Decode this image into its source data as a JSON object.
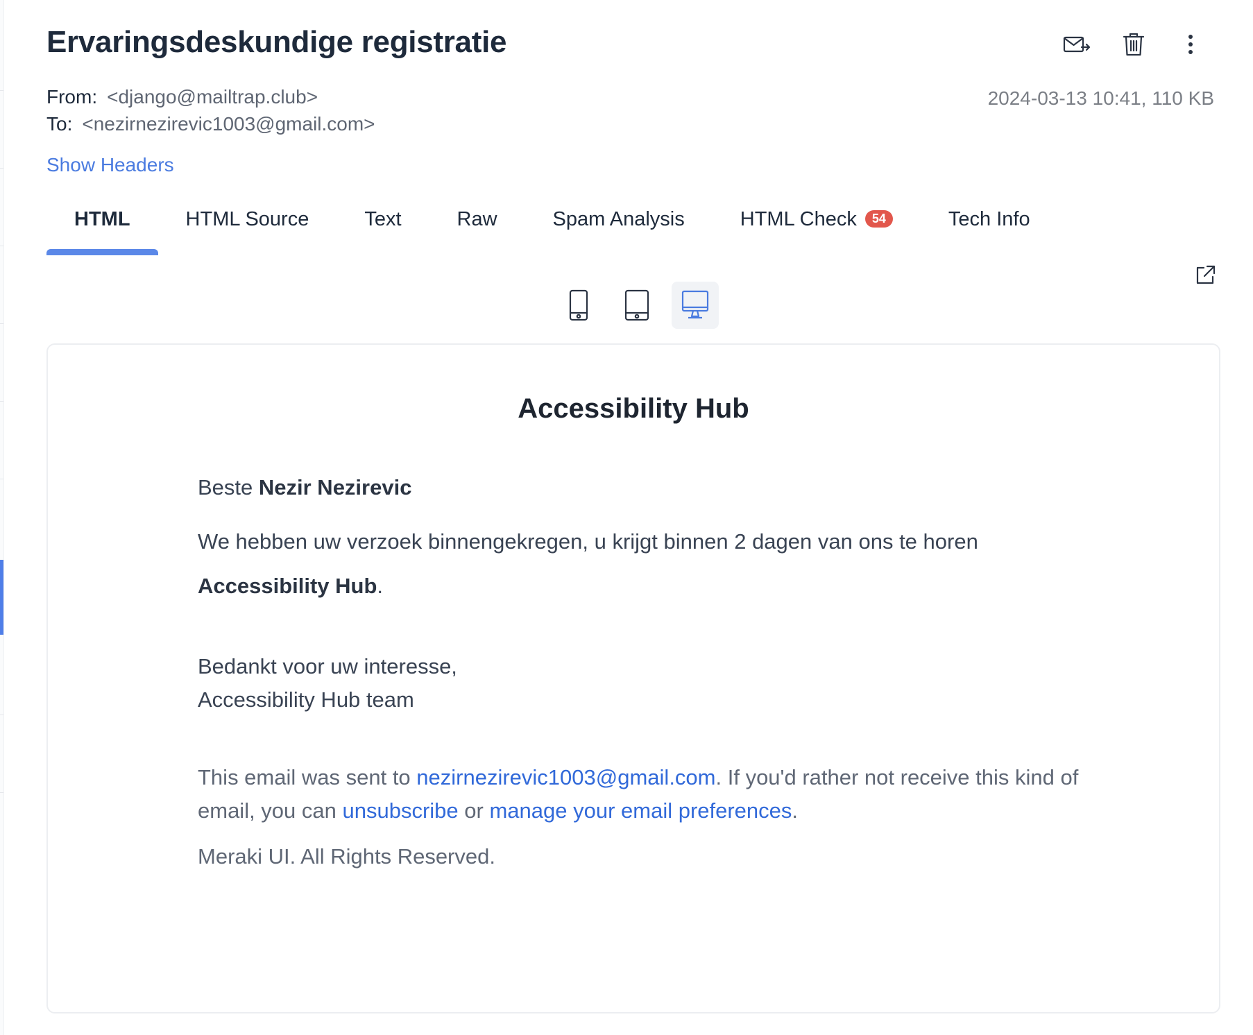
{
  "email": {
    "subject": "Ervaringsdeskundige registratie",
    "from_label": "From:",
    "from_value": "<django@mailtrap.club>",
    "to_label": "To:",
    "to_value": "<nezirnezirevic1003@gmail.com>",
    "date_size": "2024-03-13 10:41, 110 KB",
    "show_headers": "Show Headers"
  },
  "toolbar": {
    "icons": [
      "forward-mail-icon",
      "trash-icon",
      "more-vertical-icon"
    ]
  },
  "tabs": [
    {
      "label": "HTML",
      "active": true
    },
    {
      "label": "HTML Source"
    },
    {
      "label": "Text"
    },
    {
      "label": "Raw"
    },
    {
      "label": "Spam Analysis"
    },
    {
      "label": "HTML Check",
      "badge": "54"
    },
    {
      "label": "Tech Info"
    }
  ],
  "devices": {
    "options": [
      "mobile-icon",
      "tablet-icon",
      "desktop-icon"
    ],
    "selected": "desktop"
  },
  "preview": {
    "heading": "Accessibility Hub",
    "greeting_prefix": "Beste ",
    "greeting_name": "Nezir Nezirevic",
    "line1": "We hebben uw verzoek binnengekregen, u krijgt binnen 2 dagen van ons te horen",
    "line1_bold": "Accessibility Hub",
    "line1_end": ".",
    "thanks": "Bedankt voor uw interesse,",
    "team": "Accessibility Hub team",
    "footer_prefix": "This email was sent to ",
    "footer_email": "nezirnezirevic1003@gmail.com",
    "footer_mid": ". If you'd rather not receive this kind of email, you can ",
    "footer_unsubscribe": "unsubscribe",
    "footer_or": " or ",
    "footer_manage": "manage your email preferences",
    "footer_end": ".",
    "copyright": "Meraki UI. All Rights Reserved."
  },
  "colors": {
    "accent": "#4a7be0",
    "tab_underline": "#5b88e8",
    "badge": "#e2574c",
    "link": "#3169d9"
  }
}
